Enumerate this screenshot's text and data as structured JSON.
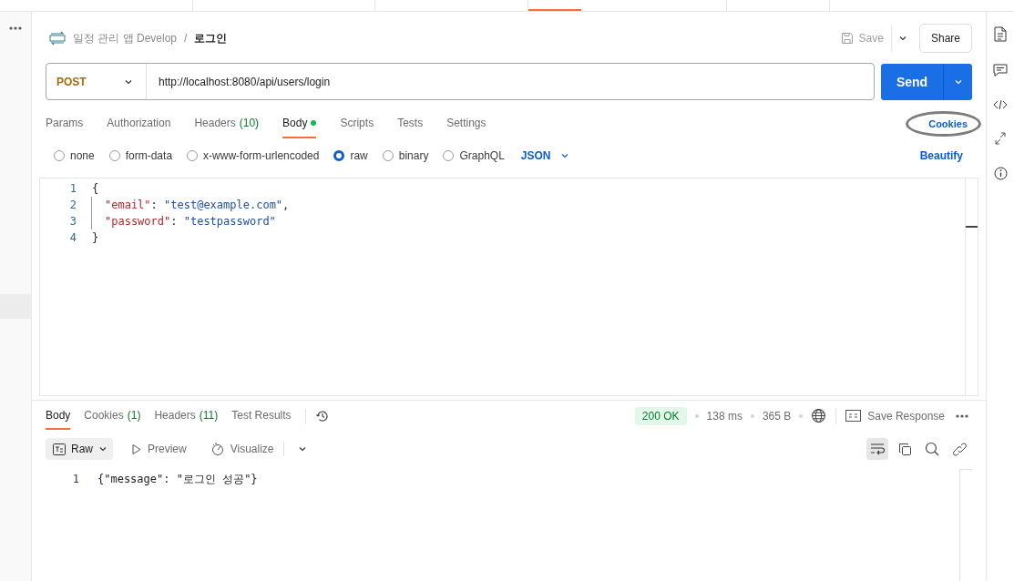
{
  "breadcrumb": {
    "collection": "일정 관리 앱 Develop",
    "separator": "/",
    "request": "로그인"
  },
  "header_actions": {
    "save": "Save",
    "share": "Share"
  },
  "request": {
    "method": "POST",
    "url": "http://localhost:8080/api/users/login",
    "send": "Send"
  },
  "request_tabs": [
    {
      "label": "Params",
      "selected": false
    },
    {
      "label": "Authorization",
      "selected": false
    },
    {
      "label": "Headers",
      "count": "(10)",
      "selected": false
    },
    {
      "label": "Body",
      "selected": true,
      "dot": true
    },
    {
      "label": "Scripts",
      "selected": false
    },
    {
      "label": "Tests",
      "selected": false
    },
    {
      "label": "Settings",
      "selected": false
    }
  ],
  "cookies_link": {
    "label": "Cookies",
    "highlighted": true
  },
  "body_types": [
    {
      "label": "none",
      "selected": false
    },
    {
      "label": "form-data",
      "selected": false
    },
    {
      "label": "x-www-form-urlencoded",
      "selected": false
    },
    {
      "label": "raw",
      "selected": true
    },
    {
      "label": "binary",
      "selected": false
    },
    {
      "label": "GraphQL",
      "selected": false
    }
  ],
  "format": "JSON",
  "beautify": "Beautify",
  "body_lines": [
    {
      "number": "1",
      "indented": false,
      "tokens": [
        {
          "kind": "punct",
          "text": "{"
        }
      ]
    },
    {
      "number": "2",
      "indented": true,
      "tokens": [
        {
          "kind": "key",
          "text": "\"email\""
        },
        {
          "kind": "punct",
          "text": ": "
        },
        {
          "kind": "string",
          "text": "\"test@example.com\""
        },
        {
          "kind": "punct",
          "text": ","
        }
      ]
    },
    {
      "number": "3",
      "indented": true,
      "tokens": [
        {
          "kind": "key",
          "text": "\"password\""
        },
        {
          "kind": "punct",
          "text": ": "
        },
        {
          "kind": "string",
          "text": "\"testpassword\""
        }
      ]
    },
    {
      "number": "4",
      "indented": false,
      "tokens": [
        {
          "kind": "punct",
          "text": "}"
        }
      ]
    }
  ],
  "response_tabs": [
    {
      "label": "Body",
      "selected": true
    },
    {
      "label": "Cookies",
      "count": "(1)",
      "selected": false
    },
    {
      "label": "Headers",
      "count": "(11)",
      "selected": false
    },
    {
      "label": "Test Results",
      "selected": false
    }
  ],
  "response_status": {
    "status": "200 OK",
    "time": "138 ms",
    "size": "365 B",
    "save_response": "Save Response"
  },
  "response_views": [
    {
      "label": "Raw",
      "selected": true
    },
    {
      "label": "Preview",
      "selected": false
    },
    {
      "label": "Visualize",
      "selected": false
    }
  ],
  "response_lines": [
    {
      "number": "1",
      "text": "{\"message\": \"로그인 성공\"}"
    }
  ]
}
